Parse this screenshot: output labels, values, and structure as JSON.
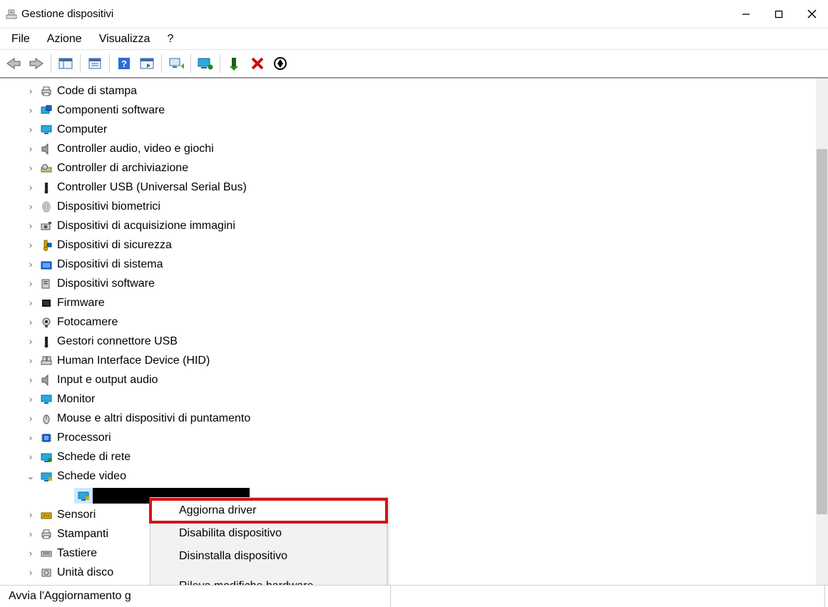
{
  "window": {
    "title": "Gestione dispositivi"
  },
  "menu": {
    "file": "File",
    "action": "Azione",
    "view": "Visualizza",
    "help": "?"
  },
  "tree": {
    "nodes": [
      {
        "label": "Code di stampa",
        "icon": "printer"
      },
      {
        "label": "Componenti software",
        "icon": "software-comp"
      },
      {
        "label": "Computer",
        "icon": "monitor"
      },
      {
        "label": "Controller audio, video e giochi",
        "icon": "speaker"
      },
      {
        "label": "Controller di archiviazione",
        "icon": "storage"
      },
      {
        "label": "Controller USB (Universal Serial Bus)",
        "icon": "usb"
      },
      {
        "label": "Dispositivi biometrici",
        "icon": "fingerprint"
      },
      {
        "label": "Dispositivi di acquisizione immagini",
        "icon": "camera"
      },
      {
        "label": "Dispositivi di sicurezza",
        "icon": "security"
      },
      {
        "label": "Dispositivi di sistema",
        "icon": "system"
      },
      {
        "label": "Dispositivi software",
        "icon": "software"
      },
      {
        "label": "Firmware",
        "icon": "firmware"
      },
      {
        "label": "Fotocamere",
        "icon": "webcam"
      },
      {
        "label": "Gestori connettore USB",
        "icon": "usb"
      },
      {
        "label": "Human Interface Device (HID)",
        "icon": "hid"
      },
      {
        "label": "Input e output audio",
        "icon": "speaker"
      },
      {
        "label": "Monitor",
        "icon": "monitor"
      },
      {
        "label": "Mouse e altri dispositivi di puntamento",
        "icon": "mouse"
      },
      {
        "label": "Processori",
        "icon": "cpu"
      },
      {
        "label": "Schede di rete",
        "icon": "network"
      },
      {
        "label": "Schede video",
        "icon": "display-adapter",
        "expanded": true
      },
      {
        "label": "Sensori",
        "icon": "sensor"
      },
      {
        "label": "Stampanti",
        "icon": "printer"
      },
      {
        "label": "Tastiere",
        "icon": "keyboard"
      },
      {
        "label": "Unità disco",
        "icon": "disk"
      }
    ]
  },
  "context_menu": {
    "items": [
      "Aggiorna driver",
      "Disabilita dispositivo",
      "Disinstalla dispositivo",
      "Rileva modifiche hardware"
    ]
  },
  "status": {
    "text": "Avvia l'Aggiornamento g"
  },
  "scrollbar": {
    "thumb_top_pct": 14,
    "thumb_height_pct": 72
  }
}
